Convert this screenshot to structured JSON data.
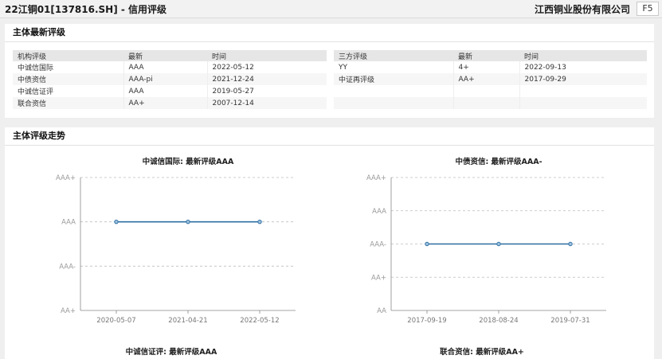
{
  "header": {
    "title": "22江铜01[137816.SH] - 信用评级",
    "company": "江西铜业股份有限公司",
    "f5_label": "F5"
  },
  "latest_ratings": {
    "section_title": "主体最新评级",
    "agency_table": {
      "columns": [
        "机构评级",
        "最新",
        "时间"
      ],
      "rows": [
        [
          "中诚信国际",
          "AAA",
          "2022-05-12"
        ],
        [
          "中债资信",
          "AAA-pi",
          "2021-12-24"
        ],
        [
          "中诚信证评",
          "AAA",
          "2019-05-27"
        ],
        [
          "联合资信",
          "AA+",
          "2007-12-14"
        ]
      ]
    },
    "third_party_table": {
      "columns": [
        "三方评级",
        "最新",
        "时间"
      ],
      "rows": [
        [
          "YY",
          "4+",
          "2022-09-13"
        ],
        [
          "中证再评级",
          "AA+",
          "2017-09-29"
        ],
        [
          "",
          "",
          ""
        ],
        [
          "",
          "",
          ""
        ]
      ]
    }
  },
  "trend": {
    "section_title": "主体评级走势"
  },
  "colors": {
    "line": "#2f6fa3",
    "marker_fill": "#9ec3e0",
    "grid": "#bdbdbd"
  },
  "chart_data": [
    {
      "type": "line",
      "title": "中诚信国际: 最新评级AAA",
      "y_categories": [
        "AA+",
        "AAA-",
        "AAA",
        "AAA+"
      ],
      "x": [
        "2020-05-07",
        "2021-04-21",
        "2022-05-12"
      ],
      "series": [
        {
          "values": [
            "AAA",
            "AAA",
            "AAA"
          ]
        }
      ]
    },
    {
      "type": "line",
      "title": "中债资信: 最新评级AAA-",
      "y_categories": [
        "AA",
        "AA+",
        "AAA-",
        "AAA",
        "AAA+"
      ],
      "x": [
        "2017-09-19",
        "2018-08-24",
        "2019-07-31"
      ],
      "series": [
        {
          "values": [
            "AAA-",
            "AAA-",
            "AAA-"
          ]
        }
      ]
    },
    {
      "type": "line",
      "title": "中诚信证评: 最新评级AAA"
    },
    {
      "type": "line",
      "title": "联合资信: 最新评级AA+"
    }
  ]
}
